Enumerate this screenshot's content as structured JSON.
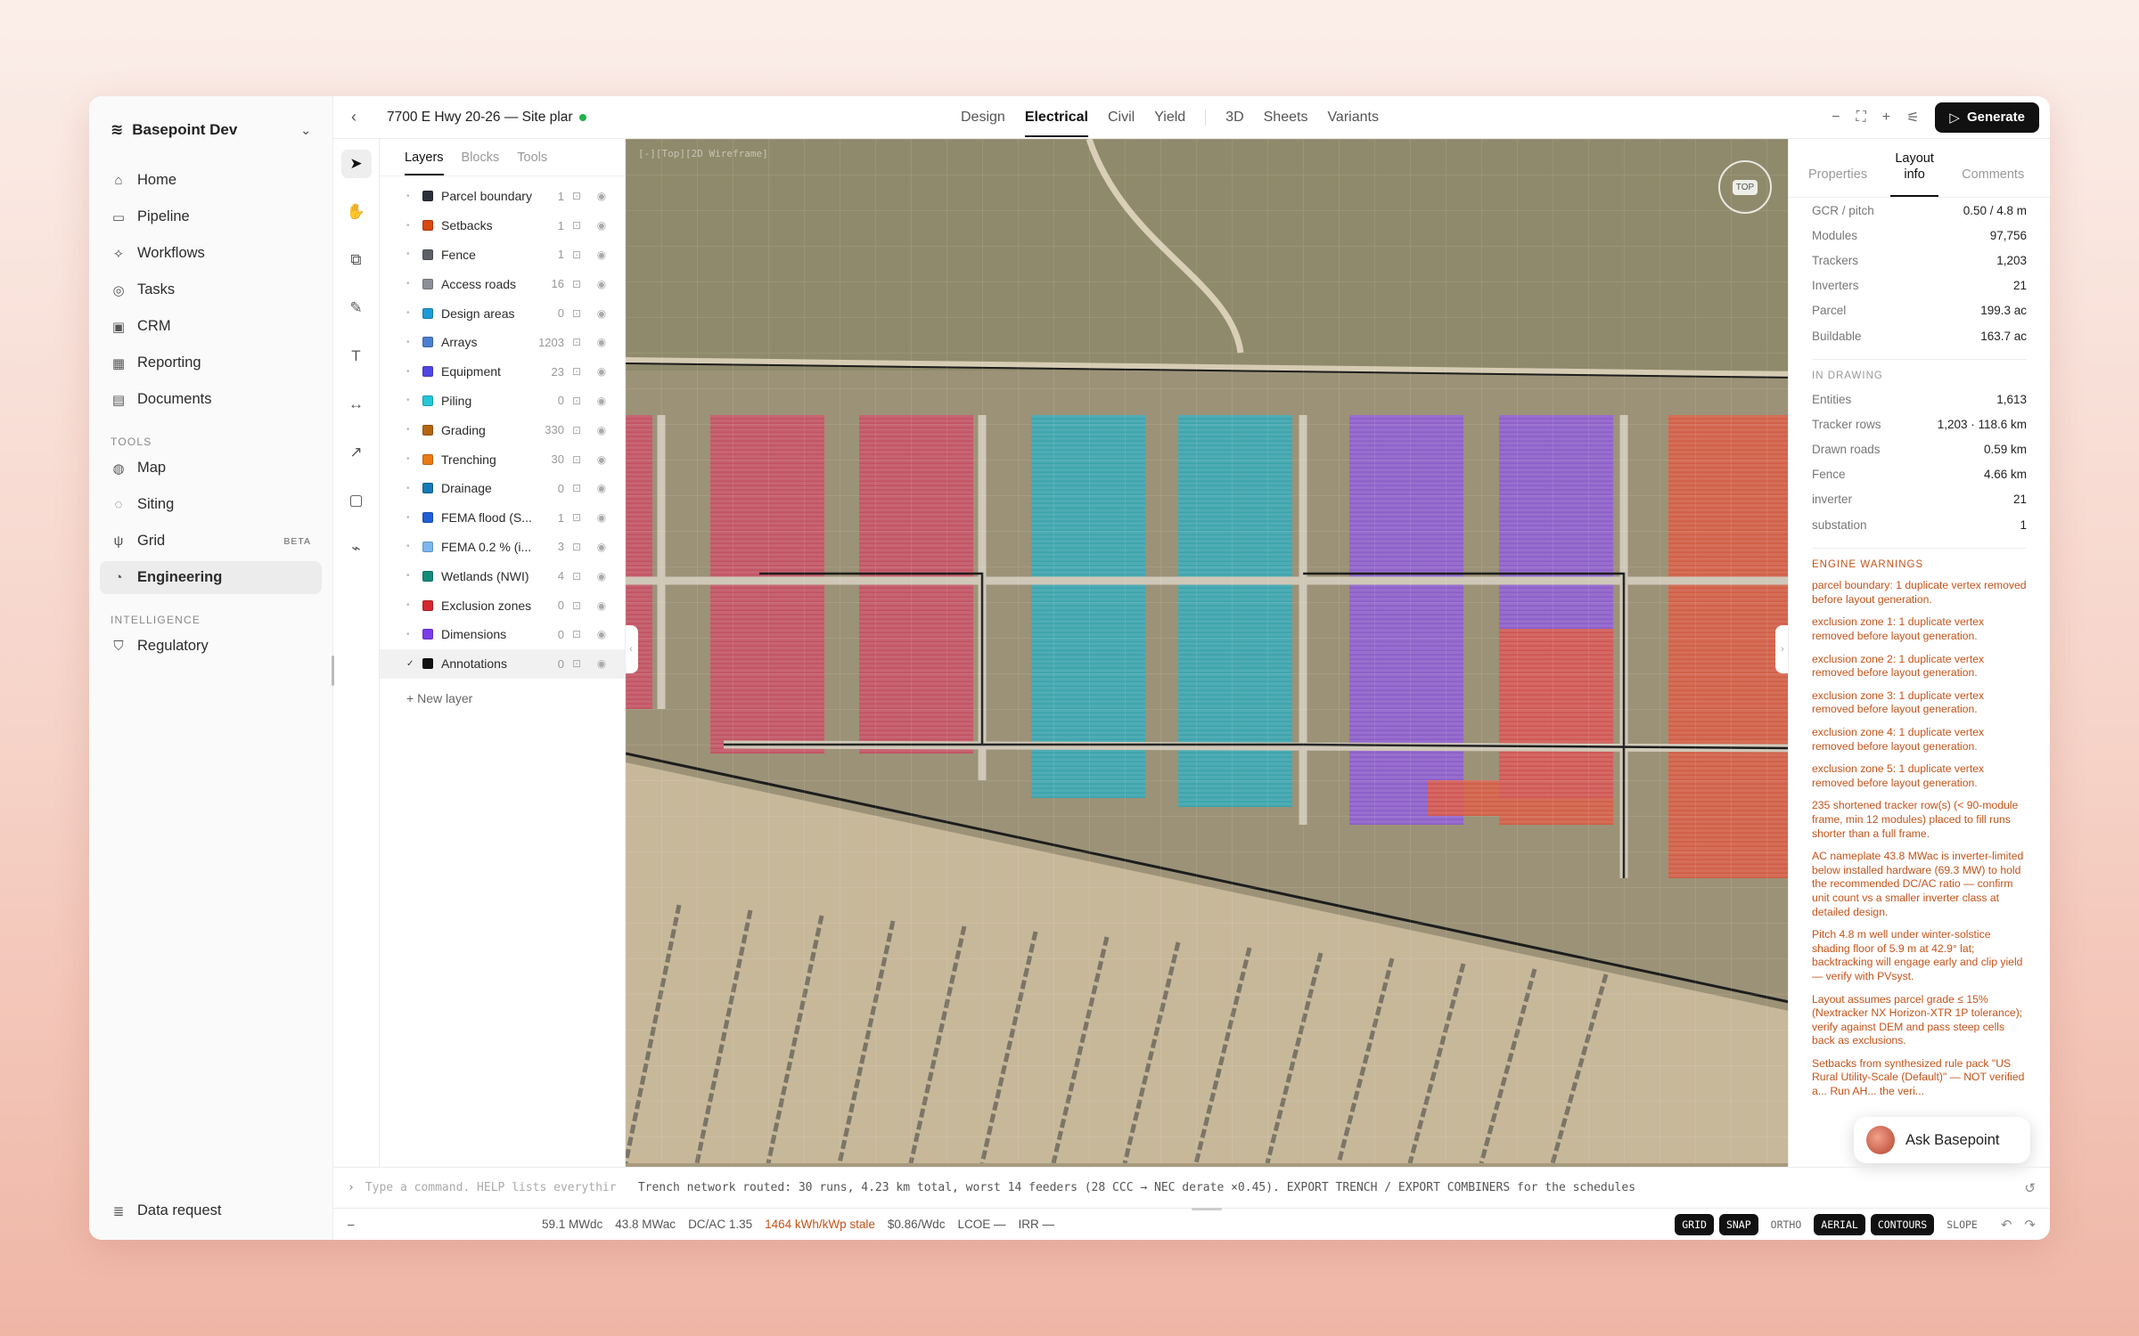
{
  "workspace": {
    "name": "Basepoint Dev"
  },
  "nav": {
    "items": [
      {
        "label": "Home",
        "icon": "home-icon",
        "glyph": "⌂"
      },
      {
        "label": "Pipeline",
        "icon": "briefcase-icon",
        "glyph": "▭"
      },
      {
        "label": "Workflows",
        "icon": "workflow-icon",
        "glyph": "⟡"
      },
      {
        "label": "Tasks",
        "icon": "check-circle-icon",
        "glyph": "◎"
      },
      {
        "label": "CRM",
        "icon": "contact-icon",
        "glyph": "▣"
      },
      {
        "label": "Reporting",
        "icon": "grid-icon",
        "glyph": "▦"
      },
      {
        "label": "Documents",
        "icon": "document-icon",
        "glyph": "▤"
      }
    ],
    "tools_label": "TOOLS",
    "tools": [
      {
        "label": "Map",
        "icon": "globe-icon",
        "glyph": "◍"
      },
      {
        "label": "Siting",
        "icon": "target-icon",
        "glyph": "◌"
      },
      {
        "label": "Grid",
        "icon": "tower-icon",
        "glyph": "ψ",
        "badge": "BETA"
      },
      {
        "label": "Engineering",
        "icon": "user-cog-icon",
        "glyph": "◔",
        "active": true
      }
    ],
    "intelligence_label": "INTELLIGENCE",
    "intelligence": [
      {
        "label": "Regulatory",
        "icon": "shield-icon",
        "glyph": "⛉"
      }
    ],
    "bottom": {
      "label": "Data request",
      "icon": "database-icon",
      "glyph": "≣"
    }
  },
  "topbar": {
    "project_title": "7700 E Hwy 20-26 — Site plar",
    "tabs": [
      "Design",
      "Electrical",
      "Civil",
      "Yield"
    ],
    "tabs2": [
      "3D",
      "Sheets",
      "Variants"
    ],
    "active_tab": "Electrical",
    "generate_label": "Generate"
  },
  "layers_panel": {
    "tabs": [
      "Layers",
      "Blocks",
      "Tools"
    ],
    "layers": [
      {
        "name": "Parcel boundary",
        "count": "1",
        "color": "#2b2f3a"
      },
      {
        "name": "Setbacks",
        "count": "1",
        "color": "#d9480f"
      },
      {
        "name": "Fence",
        "count": "1",
        "color": "#5c5f66"
      },
      {
        "name": "Access roads",
        "count": "16",
        "color": "#8d8f96"
      },
      {
        "name": "Design areas",
        "count": "0",
        "color": "#1c9bd6"
      },
      {
        "name": "Arrays",
        "count": "1203",
        "color": "#4c7fd0"
      },
      {
        "name": "Equipment",
        "count": "23",
        "color": "#4f46e5"
      },
      {
        "name": "Piling",
        "count": "0",
        "color": "#22c7d8"
      },
      {
        "name": "Grading",
        "count": "330",
        "color": "#b4650f"
      },
      {
        "name": "Trenching",
        "count": "30",
        "color": "#ea7a12"
      },
      {
        "name": "Drainage",
        "count": "0",
        "color": "#1779b8"
      },
      {
        "name": "FEMA flood (S...",
        "count": "1",
        "color": "#1f5ed6"
      },
      {
        "name": "FEMA 0.2 % (i...",
        "count": "3",
        "color": "#7cb7ef"
      },
      {
        "name": "Wetlands (NWI)",
        "count": "4",
        "color": "#138a7a"
      },
      {
        "name": "Exclusion zones",
        "count": "0",
        "color": "#d6262e"
      },
      {
        "name": "Dimensions",
        "count": "0",
        "color": "#7c3aed"
      },
      {
        "name": "Annotations",
        "count": "0",
        "color": "#111111",
        "selected": true
      }
    ],
    "new_layer_label": "New layer"
  },
  "map": {
    "view_tag": "[-][Top][2D Wireframe]",
    "compass_label": "TOP"
  },
  "right_panel": {
    "tabs": [
      "Properties",
      "Layout info",
      "Comments"
    ],
    "active_tab": "Layout info",
    "layout_stats": [
      {
        "k": "GCR / pitch",
        "v": "0.50 / 4.8 m"
      },
      {
        "k": "Modules",
        "v": "97,756"
      },
      {
        "k": "Trackers",
        "v": "1,203"
      },
      {
        "k": "Inverters",
        "v": "21"
      },
      {
        "k": "Parcel",
        "v": "199.3 ac"
      },
      {
        "k": "Buildable",
        "v": "163.7 ac"
      }
    ],
    "in_drawing_label": "IN DRAWING",
    "in_drawing": [
      {
        "k": "Entities",
        "v": "1,613"
      },
      {
        "k": "Tracker rows",
        "v": "1,203 · 118.6 km"
      },
      {
        "k": "Drawn roads",
        "v": "0.59 km"
      },
      {
        "k": "Fence",
        "v": "4.66 km"
      },
      {
        "k": "inverter",
        "v": "21"
      },
      {
        "k": "substation",
        "v": "1"
      }
    ],
    "warnings_label": "ENGINE WARNINGS",
    "warnings": [
      "parcel boundary: 1 duplicate vertex removed before layout generation.",
      "exclusion zone 1: 1 duplicate vertex removed before layout generation.",
      "exclusion zone 2: 1 duplicate vertex removed before layout generation.",
      "exclusion zone 3: 1 duplicate vertex removed before layout generation.",
      "exclusion zone 4: 1 duplicate vertex removed before layout generation.",
      "exclusion zone 5: 1 duplicate vertex removed before layout generation.",
      "235 shortened tracker row(s) (< 90-module frame, min 12 modules) placed to fill runs shorter than a full frame.",
      "AC nameplate 43.8 MWac is inverter-limited below installed hardware (69.3 MW) to hold the recommended DC/AC ratio — confirm unit count vs a smaller inverter class at detailed design.",
      "Pitch 4.8 m well under winter-solstice shading floor of 5.9 m at 42.9° lat; backtracking will engage early and clip yield — verify with PVsyst.",
      "Layout assumes parcel grade ≤ 15% (Nextracker NX Horizon-XTR 1P tolerance); verify against DEM and pass steep cells back as exclusions.",
      "Setbacks from synthesized rule pack \"US Rural Utility-Scale (Default)\" — NOT verified a... Run AH... the veri..."
    ],
    "ask_label": "Ask Basepoint"
  },
  "command_bar": {
    "placeholder": "Type a command. HELP lists everythir",
    "output": "Trench network routed: 30 runs, 4.23 km total, worst 14 feeders (28 CCC → NEC derate ×0.45). EXPORT TRENCH / EXPORT COMBINERS for the schedules"
  },
  "status_bar": {
    "left": "–",
    "metrics": [
      "59.1 MWdc",
      "43.8 MWac",
      "DC/AC 1.35"
    ],
    "stale": "1464 kWh/kWp stale",
    "metrics2": [
      "$0.86/Wdc",
      "LCOE —",
      "IRR —"
    ],
    "toggles": [
      {
        "label": "GRID",
        "on": true
      },
      {
        "label": "SNAP",
        "on": true
      },
      {
        "label": "ORTHO",
        "on": false
      },
      {
        "label": "AERIAL",
        "on": true
      },
      {
        "label": "CONTOURS",
        "on": true
      },
      {
        "label": "SLOPE",
        "on": false
      }
    ]
  },
  "colors": {
    "array_pink": "#c8465e",
    "array_teal": "#2aa6b5",
    "array_purple": "#8a55d6",
    "array_red": "#d9533c",
    "warning": "#c4531a"
  }
}
